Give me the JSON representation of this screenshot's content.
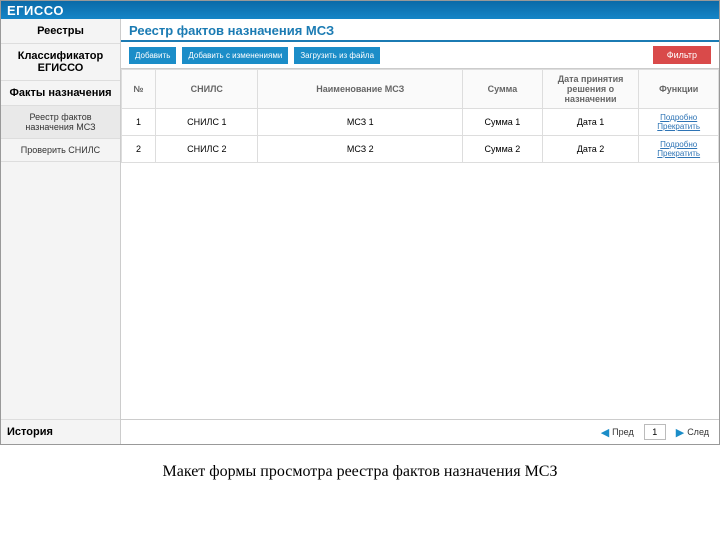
{
  "brand": "ЕГИССО",
  "sidebar": {
    "items": [
      {
        "label": "Реестры",
        "bold": true
      },
      {
        "label": "Классификатор ЕГИССО",
        "bold": true
      },
      {
        "label": "Факты назначения",
        "bold": true
      },
      {
        "label": "Реестр фактов назначения МСЗ",
        "small": true,
        "active": true
      },
      {
        "label": "Проверить СНИЛС",
        "small": true
      }
    ],
    "history": "История"
  },
  "main": {
    "title": "Реестр фактов назначения МСЗ",
    "buttons": {
      "add": "Добавить",
      "addChanges": "Добавить с изменениями",
      "upload": "Загрузить из файла",
      "filter": "Фильтр"
    },
    "columns": {
      "n": "№",
      "snils": "СНИЛС",
      "name": "Наименование МСЗ",
      "sum": "Сумма",
      "date": "Дата принятия решения о назначении",
      "func": "Функции"
    },
    "rows": [
      {
        "n": "1",
        "snils": "СНИЛС 1",
        "name": "МСЗ 1",
        "sum": "Сумма 1",
        "date": "Дата 1"
      },
      {
        "n": "2",
        "snils": "СНИЛС 2",
        "name": "МСЗ 2",
        "sum": "Сумма 2",
        "date": "Дата 2"
      }
    ],
    "funcLinks": {
      "details": "Подробно",
      "stop": "Прекратить"
    },
    "pager": {
      "prev": "Пред",
      "page": "1",
      "next": "След"
    }
  },
  "caption": "Макет формы просмотра реестра фактов назначения МСЗ"
}
